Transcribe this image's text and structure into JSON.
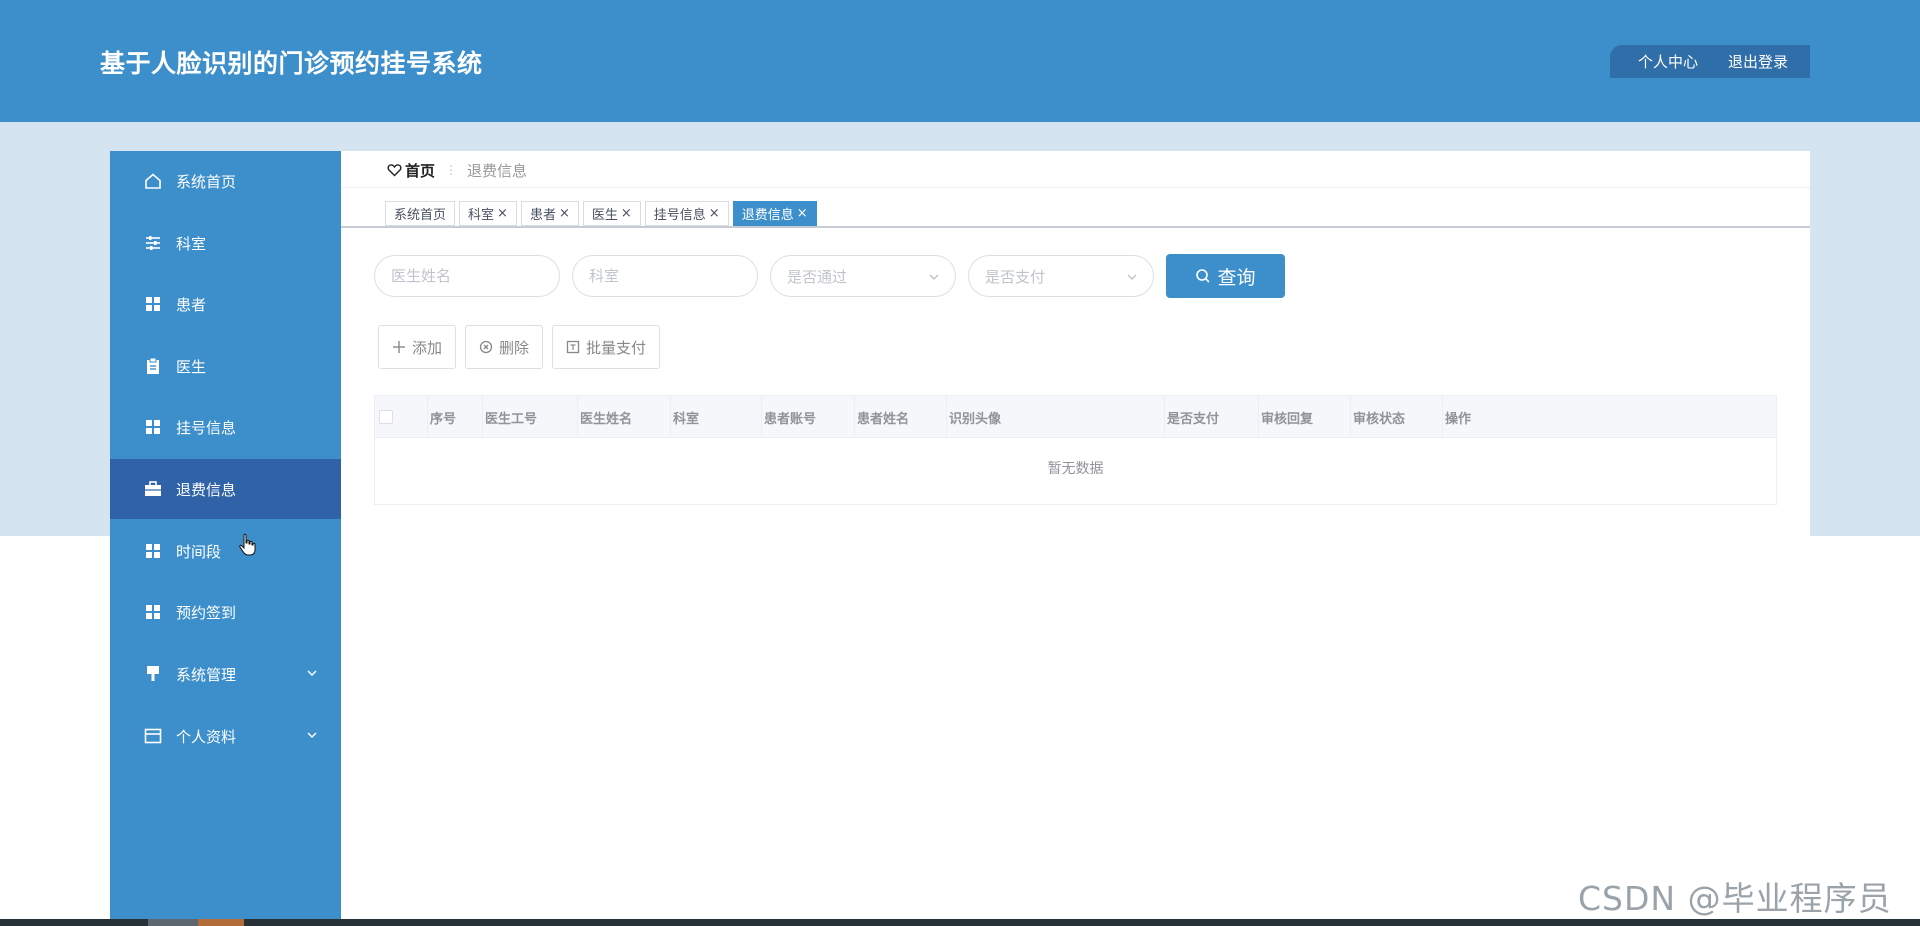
{
  "header": {
    "title": "基于人脸识别的门诊预约挂号系统",
    "user_center": "个人中心",
    "logout": "退出登录"
  },
  "sidebar": {
    "items": [
      {
        "label": "系统首页",
        "icon": "home-icon"
      },
      {
        "label": "科室",
        "icon": "sliders-icon"
      },
      {
        "label": "患者",
        "icon": "grid-icon"
      },
      {
        "label": "医生",
        "icon": "clipboard-icon"
      },
      {
        "label": "挂号信息",
        "icon": "grid-icon"
      },
      {
        "label": "退费信息",
        "icon": "briefcase-icon",
        "active": true
      },
      {
        "label": "时间段",
        "icon": "grid-icon"
      },
      {
        "label": "预约签到",
        "icon": "grid-icon"
      },
      {
        "label": "系统管理",
        "icon": "gavel-icon",
        "expandable": true
      },
      {
        "label": "个人资料",
        "icon": "card-icon",
        "expandable": true
      }
    ]
  },
  "breadcrumb": {
    "home": "首页",
    "separator": "⋮",
    "current": "退费信息"
  },
  "tabs": [
    {
      "label": "系统首页",
      "closable": false
    },
    {
      "label": "科室",
      "closable": true
    },
    {
      "label": "患者",
      "closable": true
    },
    {
      "label": "医生",
      "closable": true
    },
    {
      "label": "挂号信息",
      "closable": true
    },
    {
      "label": "退费信息",
      "closable": true,
      "active": true
    }
  ],
  "filters": {
    "doctor_name_placeholder": "医生姓名",
    "department_placeholder": "科室",
    "approved_placeholder": "是否通过",
    "paid_placeholder": "是否支付",
    "query_label": "查询"
  },
  "actions": {
    "add": "添加",
    "delete": "删除",
    "batch_pay": "批量支付"
  },
  "table": {
    "columns": [
      "序号",
      "医生工号",
      "医生姓名",
      "科室",
      "患者账号",
      "患者姓名",
      "识别头像",
      "是否支付",
      "审核回复",
      "审核状态",
      "操作"
    ],
    "empty_text": "暂无数据"
  },
  "watermark": "CSDN @毕业程序员",
  "colors": {
    "primary": "#3d8fcb",
    "active_menu": "#2f62a6",
    "panel_bg": "#d4e4f1"
  }
}
